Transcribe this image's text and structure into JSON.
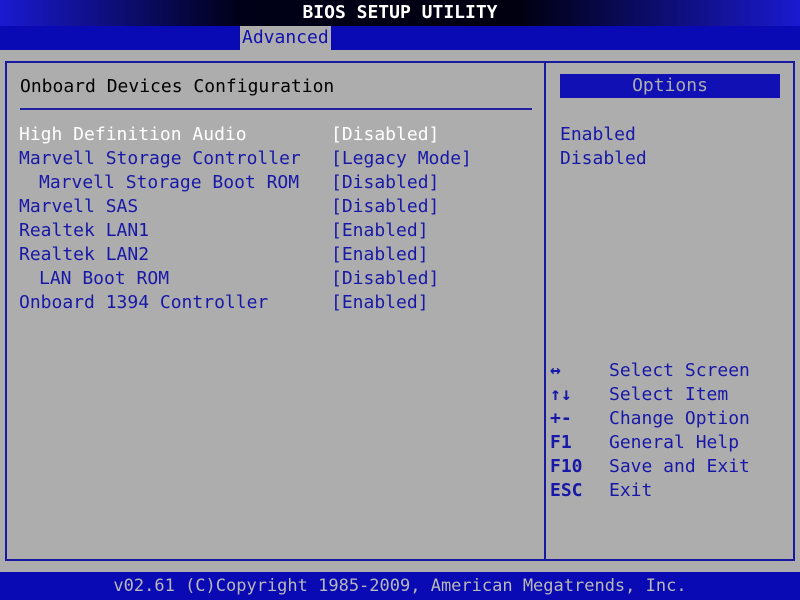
{
  "title": "BIOS SETUP UTILITY",
  "tabs": [
    {
      "label": "Advanced",
      "active": true
    }
  ],
  "main": {
    "heading": "Onboard Devices Configuration",
    "items": [
      {
        "label": "High Definition Audio",
        "value": "[Disabled]",
        "indent": 0,
        "selected": true
      },
      {
        "label": "Marvell Storage Controller",
        "value": "[Legacy Mode]",
        "indent": 0
      },
      {
        "label": "Marvell Storage Boot ROM",
        "value": "[Disabled]",
        "indent": 1
      },
      {
        "label": "Marvell SAS",
        "value": "[Disabled]",
        "indent": 0
      },
      {
        "label": "Realtek LAN1",
        "value": "[Enabled]",
        "indent": 0
      },
      {
        "label": "Realtek LAN2",
        "value": "[Enabled]",
        "indent": 0
      },
      {
        "label": "LAN Boot ROM",
        "value": "[Disabled]",
        "indent": 1
      },
      {
        "label": "Onboard 1394 Controller",
        "value": "[Enabled]",
        "indent": 0
      }
    ]
  },
  "options": {
    "heading": "Options",
    "items": [
      "Enabled",
      "Disabled"
    ]
  },
  "help": [
    {
      "key": "↔",
      "desc": "Select Screen"
    },
    {
      "key": "↑↓",
      "desc": "Select Item"
    },
    {
      "key": "+-",
      "desc": "Change Option"
    },
    {
      "key": "F1",
      "desc": "General Help"
    },
    {
      "key": "F10",
      "desc": "Save and Exit"
    },
    {
      "key": "ESC",
      "desc": "Exit"
    }
  ],
  "footer": "v02.61 (C)Copyright 1985-2009, American Megatrends, Inc.",
  "colors": {
    "blue": "#0a0ab4",
    "grey": "#adadad"
  }
}
